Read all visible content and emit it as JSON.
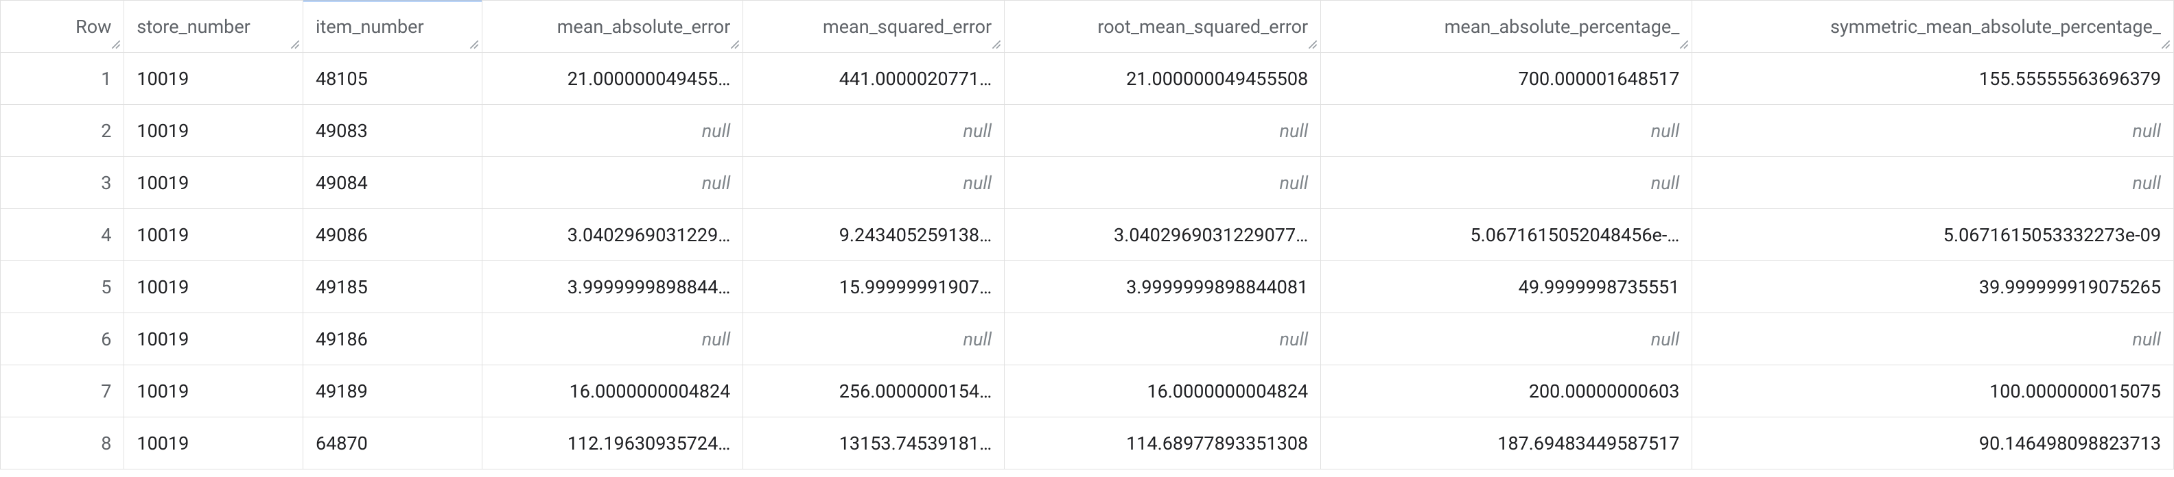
{
  "columns": {
    "row": "Row",
    "store_number": "store_number",
    "item_number": "item_number",
    "mean_absolute_error": "mean_absolute_error",
    "mean_squared_error": "mean_squared_error",
    "root_mean_squared_error": "root_mean_squared_error",
    "mean_absolute_percentage": "mean_absolute_percentage_",
    "symmetric_mean_absolute_percentage": "symmetric_mean_absolute_percentage_"
  },
  "null_label": "null",
  "rows": [
    {
      "row": "1",
      "store_number": "10019",
      "item_number": "48105",
      "mae": "21.000000049455…",
      "mse": "441.0000020771…",
      "rmse": "21.000000049455508",
      "mape": "700.000001648517",
      "smape": "155.55555563696379"
    },
    {
      "row": "2",
      "store_number": "10019",
      "item_number": "49083",
      "mae": null,
      "mse": null,
      "rmse": null,
      "mape": null,
      "smape": null
    },
    {
      "row": "3",
      "store_number": "10019",
      "item_number": "49084",
      "mae": null,
      "mse": null,
      "rmse": null,
      "mape": null,
      "smape": null
    },
    {
      "row": "4",
      "store_number": "10019",
      "item_number": "49086",
      "mae": "3.0402969031229…",
      "mse": "9.243405259138…",
      "rmse": "3.0402969031229077…",
      "mape": "5.0671615052048456e-…",
      "smape": "5.0671615053332273e-09"
    },
    {
      "row": "5",
      "store_number": "10019",
      "item_number": "49185",
      "mae": "3.9999999898844…",
      "mse": "15.99999991907…",
      "rmse": "3.9999999898844081",
      "mape": "49.9999998735551",
      "smape": "39.999999919075265"
    },
    {
      "row": "6",
      "store_number": "10019",
      "item_number": "49186",
      "mae": null,
      "mse": null,
      "rmse": null,
      "mape": null,
      "smape": null
    },
    {
      "row": "7",
      "store_number": "10019",
      "item_number": "49189",
      "mae": "16.0000000004824",
      "mse": "256.0000000154…",
      "rmse": "16.0000000004824",
      "mape": "200.00000000603",
      "smape": "100.0000000015075"
    },
    {
      "row": "8",
      "store_number": "10019",
      "item_number": "64870",
      "mae": "112.19630935724…",
      "mse": "13153.74539181…",
      "rmse": "114.68977893351308",
      "mape": "187.69483449587517",
      "smape": "90.146498098823713"
    }
  ]
}
